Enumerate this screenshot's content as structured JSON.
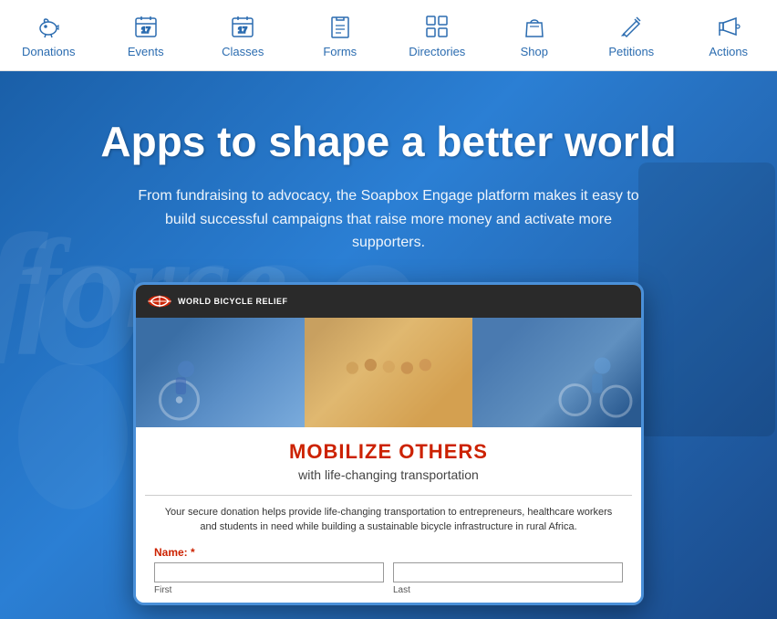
{
  "nav": {
    "items": [
      {
        "id": "donations",
        "label": "Donations",
        "icon": "piggy-bank"
      },
      {
        "id": "events",
        "label": "Events",
        "icon": "calendar-17"
      },
      {
        "id": "classes",
        "label": "Classes",
        "icon": "calendar-17"
      },
      {
        "id": "forms",
        "label": "Forms",
        "icon": "clipboard"
      },
      {
        "id": "directories",
        "label": "Directories",
        "icon": "grid"
      },
      {
        "id": "shop",
        "label": "Shop",
        "icon": "bag"
      },
      {
        "id": "petitions",
        "label": "Petitions",
        "icon": "pencil"
      },
      {
        "id": "actions",
        "label": "Actions",
        "icon": "megaphone"
      }
    ]
  },
  "hero": {
    "title": "Apps to shape a better world",
    "subtitle": "From fundraising to advocacy, the Soapbox Engage platform makes it easy to build successful campaigns that raise more money and activate more supporters."
  },
  "form_card": {
    "org_name": "WORLD BICYCLE RELIEF",
    "mobilize_title": "MOBILIZE OTHERS",
    "mobilize_subtitle": "with life-changing transportation",
    "description": "Your secure donation helps provide life-changing transportation to entrepreneurs, healthcare workers and students in need while building a sustainable bicycle infrastructure in rural Africa.",
    "name_label": "Name:",
    "first_label": "First",
    "last_label": "Last"
  }
}
